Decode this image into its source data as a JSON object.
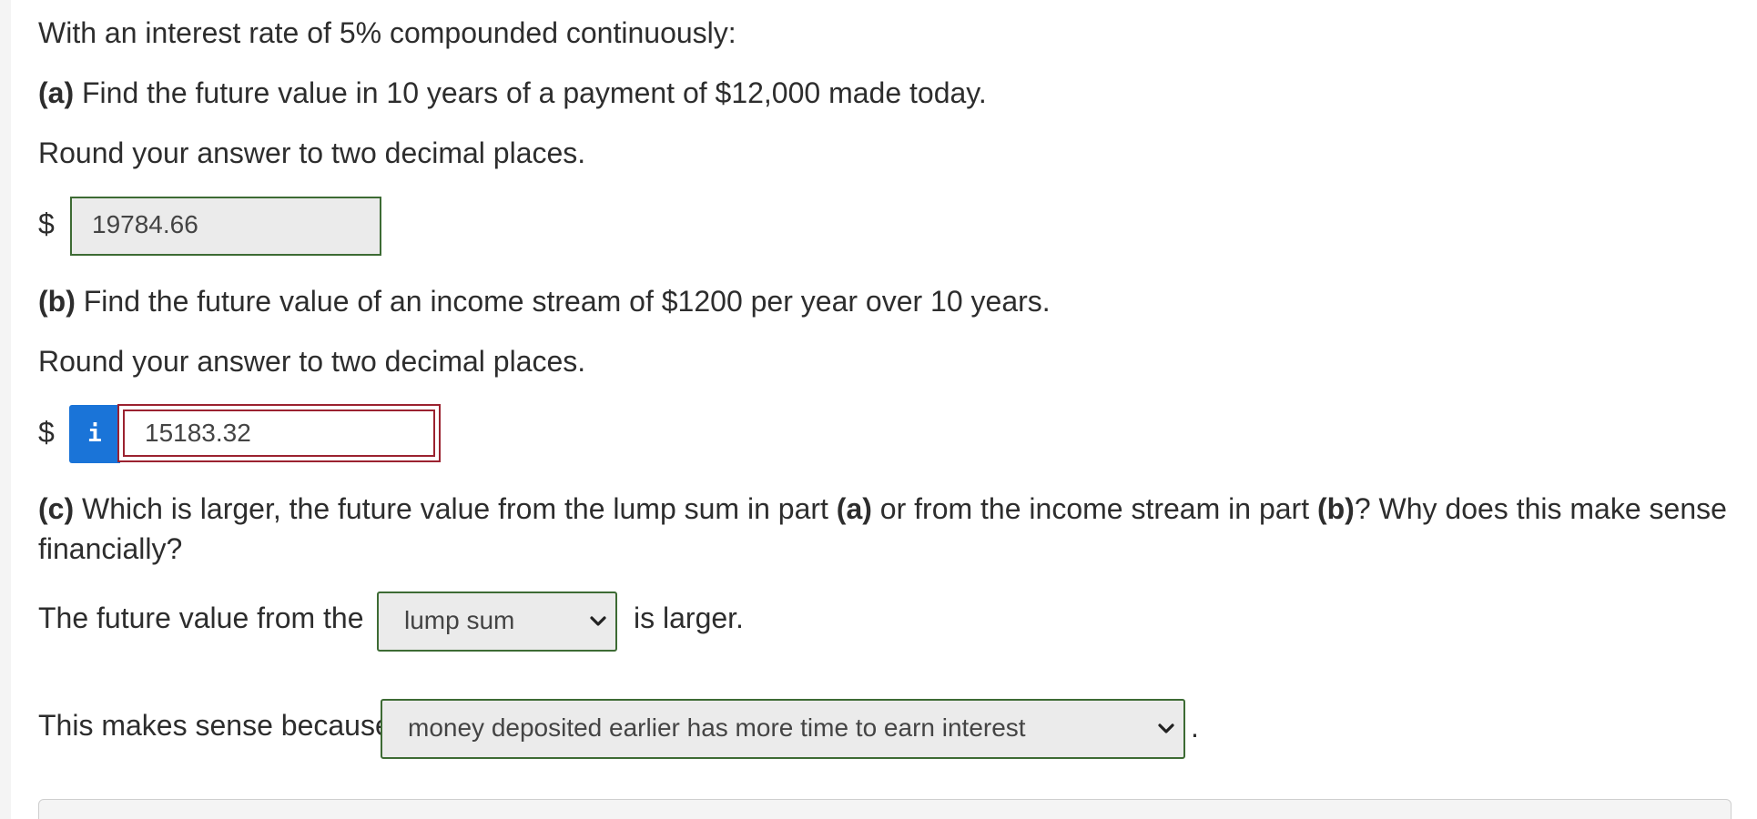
{
  "intro": "With an interest rate of 5% compounded continuously:",
  "part_a": {
    "label": "(a)",
    "question": " Find the future value in 10 years of a payment of $12,000 made today.",
    "instruction": "Round your answer to two decimal places.",
    "currency": "$",
    "answer": "19784.66"
  },
  "part_b": {
    "label": "(b)",
    "question": " Find the future value of an income stream of $1200 per year over 10 years.",
    "instruction": "Round your answer to two decimal places.",
    "currency": "$",
    "info_glyph": "i",
    "answer": "15183.32"
  },
  "part_c": {
    "label": "(c)",
    "question_1": " Which is larger, the future value from the lump sum in part ",
    "ref_a": "(a)",
    "question_2": " or from the income stream in part ",
    "ref_b": "(b)",
    "question_3": "? Why does this make sense",
    "question_4": "financially?",
    "sentence1_prefix": "The future value from the",
    "select1_value": "lump sum",
    "sentence1_suffix": "is larger.",
    "sentence2_prefix": "This makes sense because",
    "select2_value": "money deposited earlier has more time to earn interest",
    "sentence2_suffix": "."
  },
  "colors": {
    "correct_border": "#3d6b34",
    "incorrect_border": "#9b2230",
    "info_blue": "#1a74d8",
    "field_bg": "#ebebeb"
  },
  "icons": {
    "info": "info-icon",
    "dropdown": "chevron-down-icon"
  }
}
